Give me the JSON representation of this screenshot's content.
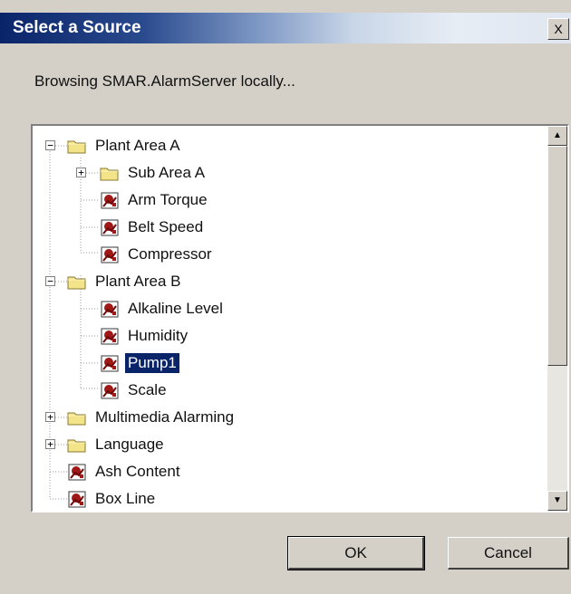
{
  "window": {
    "title": "Select a Source",
    "close_glyph": "X"
  },
  "status_text": "Browsing SMAR.AlarmServer locally...",
  "tree": [
    {
      "label": "Plant Area A",
      "type": "folder",
      "expander": "−",
      "level": 0,
      "selected": false
    },
    {
      "label": "Sub Area A",
      "type": "folder",
      "expander": "+",
      "level": 1,
      "selected": false
    },
    {
      "label": "Arm Torque",
      "type": "alarm-tag",
      "expander": "",
      "level": 1,
      "selected": false
    },
    {
      "label": "Belt Speed",
      "type": "alarm-tag",
      "expander": "",
      "level": 1,
      "selected": false
    },
    {
      "label": "Compressor",
      "type": "alarm-tag",
      "expander": "",
      "level": 1,
      "selected": false
    },
    {
      "label": "Plant Area B",
      "type": "folder",
      "expander": "−",
      "level": 0,
      "selected": false
    },
    {
      "label": "Alkaline Level",
      "type": "alarm-tag",
      "expander": "",
      "level": 1,
      "selected": false
    },
    {
      "label": "Humidity",
      "type": "alarm-tag",
      "expander": "",
      "level": 1,
      "selected": false
    },
    {
      "label": "Pump1",
      "type": "alarm-tag",
      "expander": "",
      "level": 1,
      "selected": true
    },
    {
      "label": "Scale",
      "type": "alarm-tag",
      "expander": "",
      "level": 1,
      "selected": false
    },
    {
      "label": "Multimedia Alarming",
      "type": "folder",
      "expander": "+",
      "level": 0,
      "selected": false
    },
    {
      "label": "Language",
      "type": "folder",
      "expander": "+",
      "level": 0,
      "selected": false
    },
    {
      "label": "Ash Content",
      "type": "alarm-tag",
      "expander": "",
      "level": 0,
      "selected": false
    },
    {
      "label": "Box Line",
      "type": "alarm-tag",
      "expander": "",
      "level": 0,
      "selected": false
    }
  ],
  "buttons": {
    "ok": "OK",
    "cancel": "Cancel"
  },
  "icons": {
    "folder": "folder-icon",
    "alarm": "alarm-tag-icon"
  },
  "colors": {
    "selection": "#0a246a",
    "folder": "#f3e48a",
    "alarm": "#a01818"
  }
}
